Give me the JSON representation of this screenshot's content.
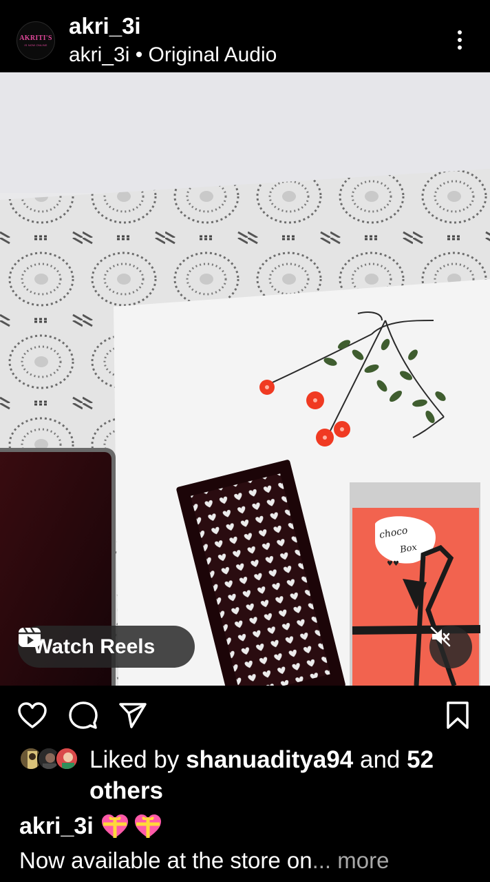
{
  "post": {
    "avatar_text_top": "AKRITI'S",
    "avatar_text_bottom": "IS NOW ONLINE",
    "username": "akri_3i",
    "subtitle": "akri_3i • Original Audio"
  },
  "media": {
    "watch_reels_label": "Watch Reels",
    "box_label_line1": "choco",
    "box_label_line2": "Box",
    "box_label_line3": "♥♥",
    "mute_icon": "speaker-muted-icon"
  },
  "actions": {
    "like_icon": "heart-outline-icon",
    "comment_icon": "comment-icon",
    "share_icon": "paper-plane-icon",
    "save_icon": "bookmark-icon"
  },
  "likes": {
    "prefix": "Liked by ",
    "user": "shanuaditya94",
    "middle": " and ",
    "count": "52 others"
  },
  "caption": {
    "username": "akri_3i",
    "emojis": "💝💝",
    "text": "Now available at the store on",
    "ellipsis": "... ",
    "more": "more"
  },
  "colors": {
    "background": "#000000",
    "accent_pink": "#e0479a",
    "muted_text": "#a8a8a8"
  }
}
